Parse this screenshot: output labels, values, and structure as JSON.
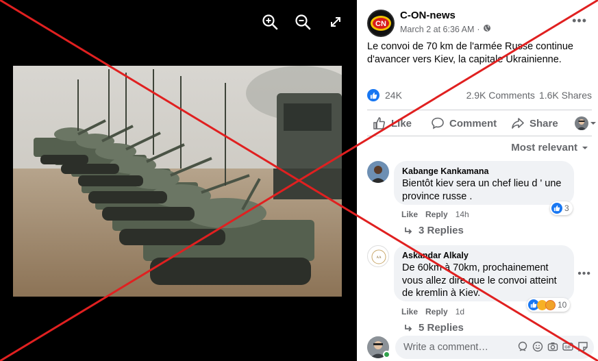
{
  "viewer": {
    "tools": [
      {
        "name": "zoom-in-icon"
      },
      {
        "name": "zoom-out-icon"
      },
      {
        "name": "fullscreen-icon"
      }
    ]
  },
  "post": {
    "page_name": "C-ON-news",
    "logo_text": "CN",
    "timestamp": "March 2 at 6:36 AM",
    "audience_sep": "·",
    "text": "Le convoi de 70 km de l'armée Russe continue d'avancer vers Kiev, la capitale Ukrainienne.",
    "reactions_count": "24K",
    "comments_count": "2.9K Comments",
    "shares_count": "1.6K Shares"
  },
  "actions": {
    "like": "Like",
    "comment": "Comment",
    "share": "Share"
  },
  "sort_label": "Most relevant",
  "comments": [
    {
      "author": "Kabange Kankamana",
      "text_line1": "Bientôt kiev sera un chef lieu d ' une",
      "text_line2": "province russe .",
      "like_label": "Like",
      "reply_label": "Reply",
      "time": "14h",
      "reaction_count": "3",
      "replies": "3 Replies"
    },
    {
      "author": "Askandar Alkaly",
      "text_line1": "De 60km à 70km, prochainement",
      "text_line2": "vous allez dire que le convoi atteint",
      "text_line3": "de kremlin à Kiev.",
      "like_label": "Like",
      "reply_label": "Reply",
      "time": "1d",
      "reaction_count": "10",
      "replies": "5 Replies"
    }
  ],
  "composer": {
    "placeholder": "Write a comment…"
  },
  "colors": {
    "accent": "#1877f2",
    "overlay_x": "#e02020"
  }
}
